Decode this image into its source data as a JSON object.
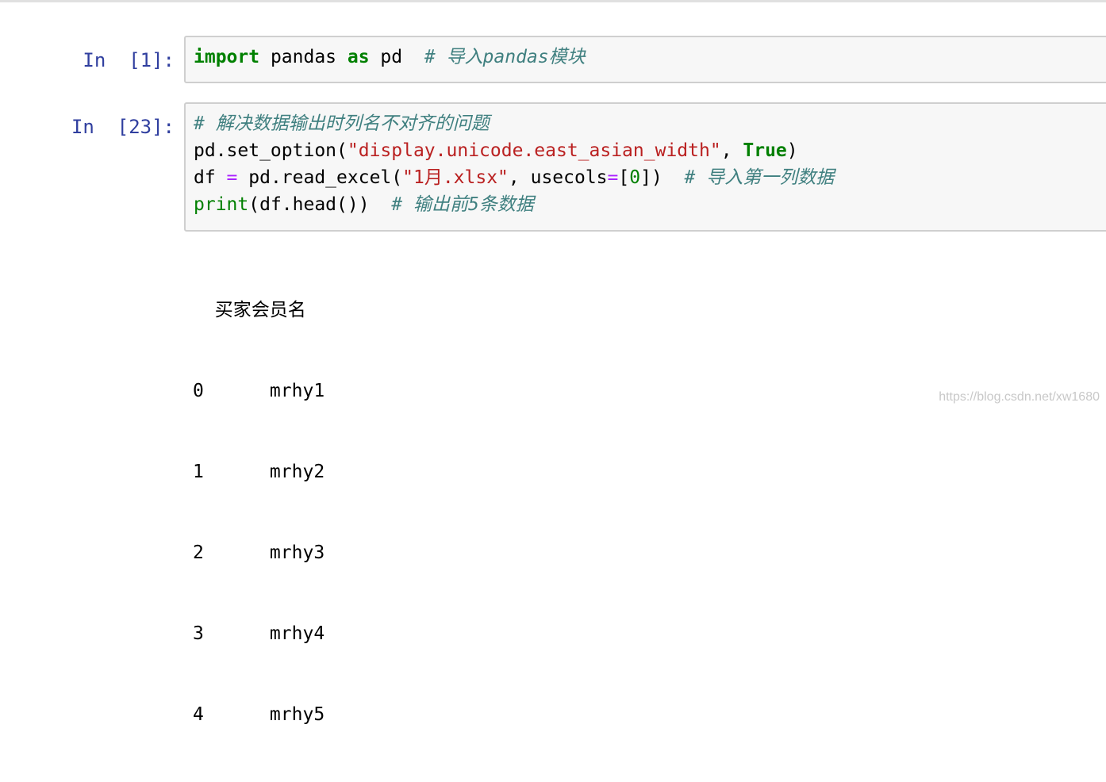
{
  "cells": [
    {
      "prompt": "In  [1]:",
      "code": {
        "kw_import": "import",
        "mod": " pandas ",
        "kw_as": "as",
        "alias": " pd  ",
        "comment": "# 导入pandas模块"
      }
    },
    {
      "prompt": "In  [23]:",
      "code": {
        "l1_comment": "# 解决数据输出时列名不对齐的问题",
        "l2_pre": "pd.set_option(",
        "l2_str": "\"display.unicode.east_asian_width\"",
        "l2_mid": ", ",
        "l2_true": "True",
        "l2_post": ")",
        "l3_pre": "df ",
        "l3_eq1": "=",
        "l3_mid": " pd.read_excel(",
        "l3_str": "\"1月.xlsx\"",
        "l3_mid2": ", usecols",
        "l3_eq2": "=",
        "l3_lb": "[",
        "l3_num": "0",
        "l3_rb": "])  ",
        "l3_comment": "# 导入第一列数据",
        "l4_print": "print",
        "l4_rest": "(df.head())  ",
        "l4_comment": "# 输出前5条数据"
      },
      "output": [
        "  买家会员名",
        "0      mrhy1",
        "1      mrhy2",
        "2      mrhy3",
        "3      mrhy4",
        "4      mrhy5"
      ]
    }
  ],
  "watermark": "https://blog.csdn.net/xw1680"
}
